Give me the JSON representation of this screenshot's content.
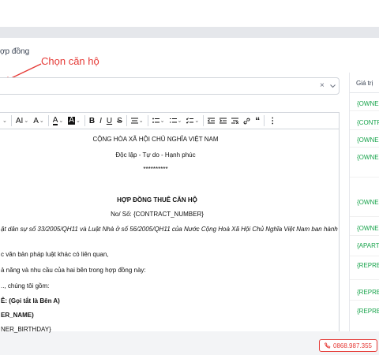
{
  "breadcrumb": "ợp đồng",
  "annotation": "Chọn căn hộ",
  "select": {
    "clear_icon": "×",
    "dropdown_icon": "chevron-down"
  },
  "toolbar": {
    "font_size": "AI",
    "text_height": "A",
    "font_color": "A",
    "bg_color": "A",
    "bold": "B",
    "italic": "I",
    "underline": "U",
    "strike": "S",
    "quote": "“",
    "more": "⋮"
  },
  "document": {
    "line1": "CỘNG HÒA XÃ HỘI CHỦ NGHĨA VIỆT NAM",
    "line2": "Độc lập - Tự do - Hạnh phúc",
    "line3": "**********",
    "title": "HỢP ĐỒNG THUÊ CĂN HỘ",
    "number": "No/ Số: {CONTRACT_NUMBER}",
    "legal": "ật dân sự số 33/2005/QH11 và Luật Nhà ở số 56/2005/QH11 của Nước Cộng Hoà Xã Hội Chủ Nghĩa Việt Nam ban hành",
    "docs": "c văn bản pháp luật khác có liên quan,",
    "ability": "ả năng và nhu cầu của hai bên trong hợp đồng này:",
    "parties": ".., chúng tôi gồm:",
    "party_a": "Ê: (Gọi tắt là Bên A)",
    "owner_name": "ER_NAME)",
    "owner_birthday": "NER_BIRTHDAY}"
  },
  "panel": {
    "header": "Giá trị",
    "rows": [
      "{OWNER",
      "{CONTR",
      "{OWNER",
      "{OWNER",
      "{OWNER",
      "{OWNER",
      "{APART",
      "{REPRE",
      "{REPRE",
      "{REPRE",
      "{REPRE"
    ]
  },
  "phone": {
    "number": "0868.987.355"
  }
}
